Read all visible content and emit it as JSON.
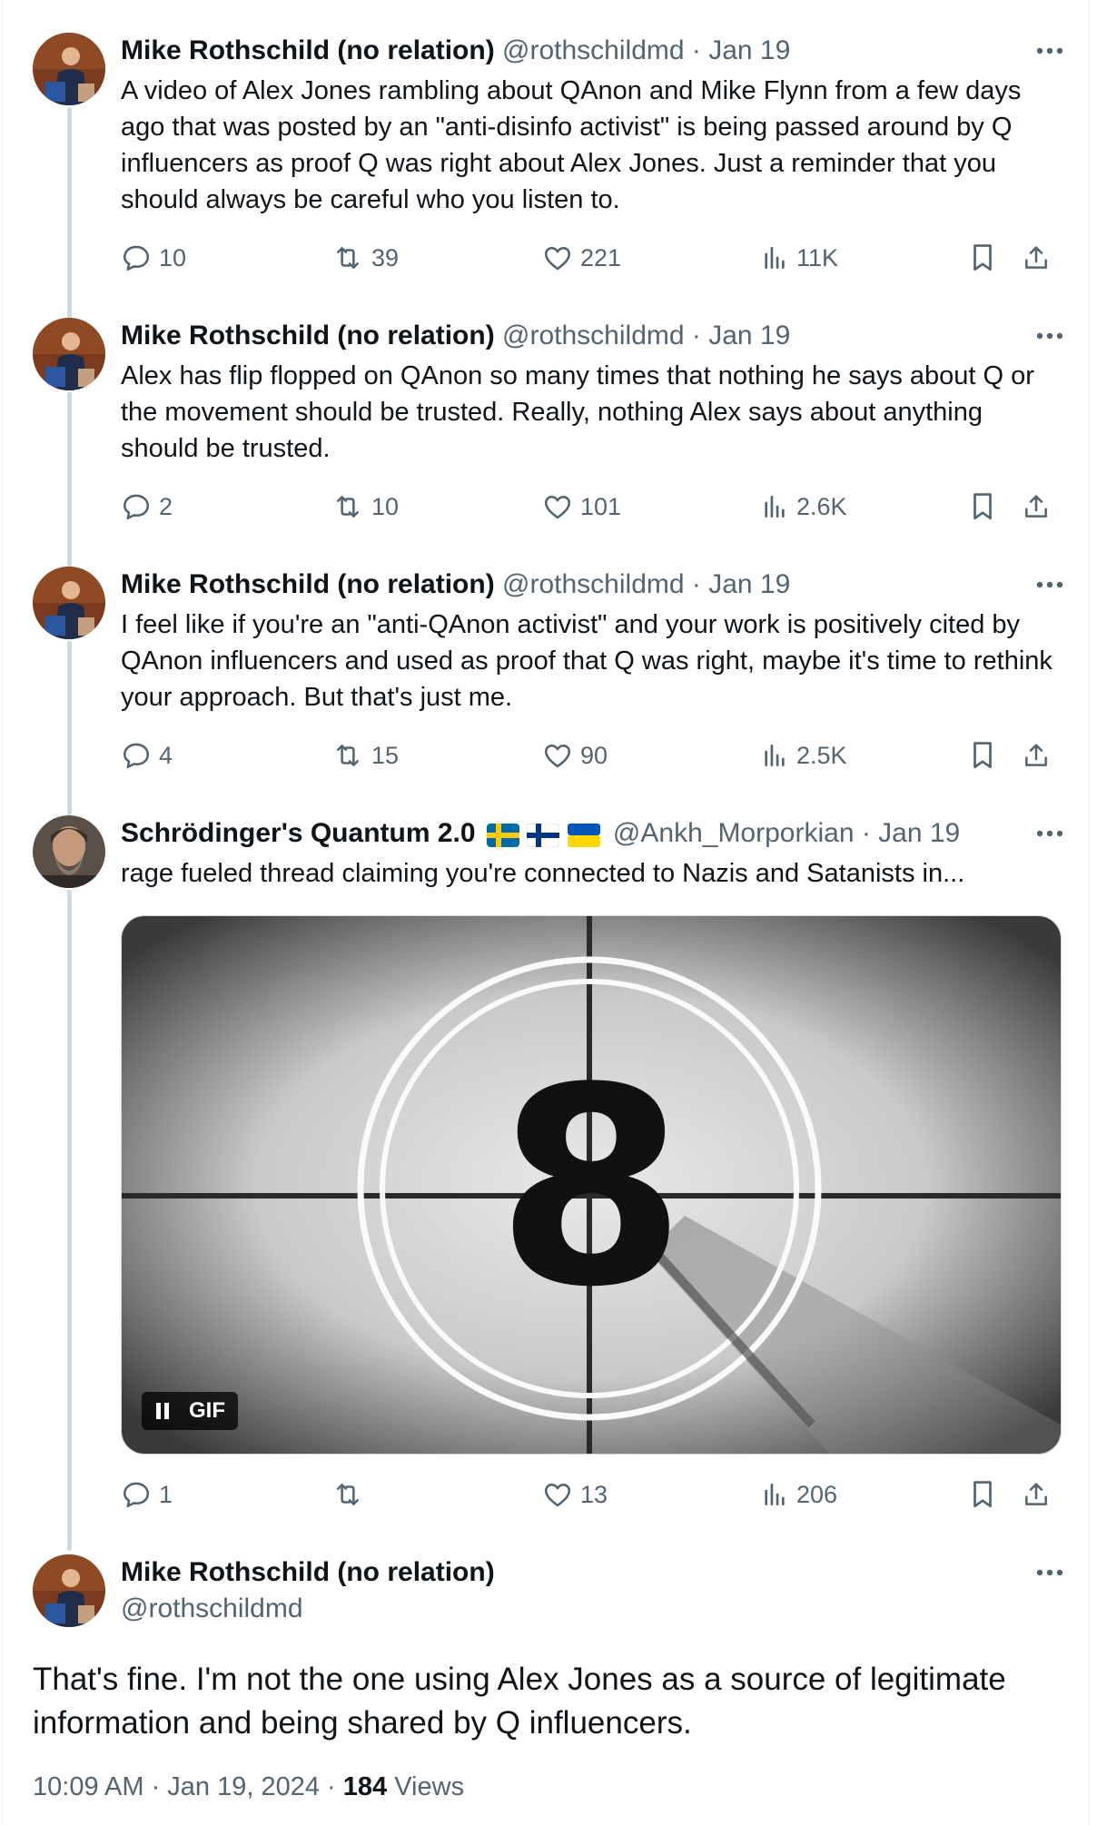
{
  "tweets": [
    {
      "name": "Mike Rothschild (no relation)",
      "handle": "@rothschildmd",
      "date": "· Jan 19",
      "text": "A video of Alex Jones rambling about QAnon and Mike Flynn from a few days ago that was posted by an \"anti-disinfo activist\" is being passed around by Q influencers as proof Q was right about Alex Jones. Just a reminder that you should always be careful who you listen to.",
      "replies": "10",
      "reposts": "39",
      "likes": "221",
      "views": "11K"
    },
    {
      "name": "Mike Rothschild (no relation)",
      "handle": "@rothschildmd",
      "date": "· Jan 19",
      "text": "Alex has flip flopped on QAnon so many times that nothing he says about Q or the movement should be trusted. Really, nothing Alex says about anything should be trusted.",
      "replies": "2",
      "reposts": "10",
      "likes": "101",
      "views": "2.6K"
    },
    {
      "name": "Mike Rothschild (no relation)",
      "handle": "@rothschildmd",
      "date": "· Jan 19",
      "text": "I feel like if you're an \"anti-QAnon activist\" and your work is positively cited by QAnon influencers and used as proof that Q was right, maybe it's time to rethink your approach. But that's just me.",
      "replies": "4",
      "reposts": "15",
      "likes": "90",
      "views": "2.5K"
    },
    {
      "name": "Schrödinger's Quantum 2.0",
      "handle": "@Ankh_Morporkian",
      "date": "· Jan 19",
      "flags": [
        "sweden-flag-icon",
        "finland-flag-icon",
        "ukraine-flag-icon"
      ],
      "text": "rage fueled thread claiming you're connected to Nazis and Satanists in...",
      "media": {
        "countdown_number": "8",
        "badge_label": "GIF"
      },
      "replies": "1",
      "reposts": "",
      "likes": "13",
      "views": "206"
    }
  ],
  "main_tweet": {
    "name": "Mike Rothschild (no relation)",
    "handle": "@rothschildmd",
    "text": "That's fine. I'm not the one using Alex Jones as a source of legitimate information and being shared by Q influencers.",
    "time": "10:09 AM · Jan 19, 2024 ·",
    "views_count": "184",
    "views_label": "Views"
  },
  "colors": {
    "text": "#0f1419",
    "secondary": "#536471",
    "thread_line": "#cfd9de"
  }
}
